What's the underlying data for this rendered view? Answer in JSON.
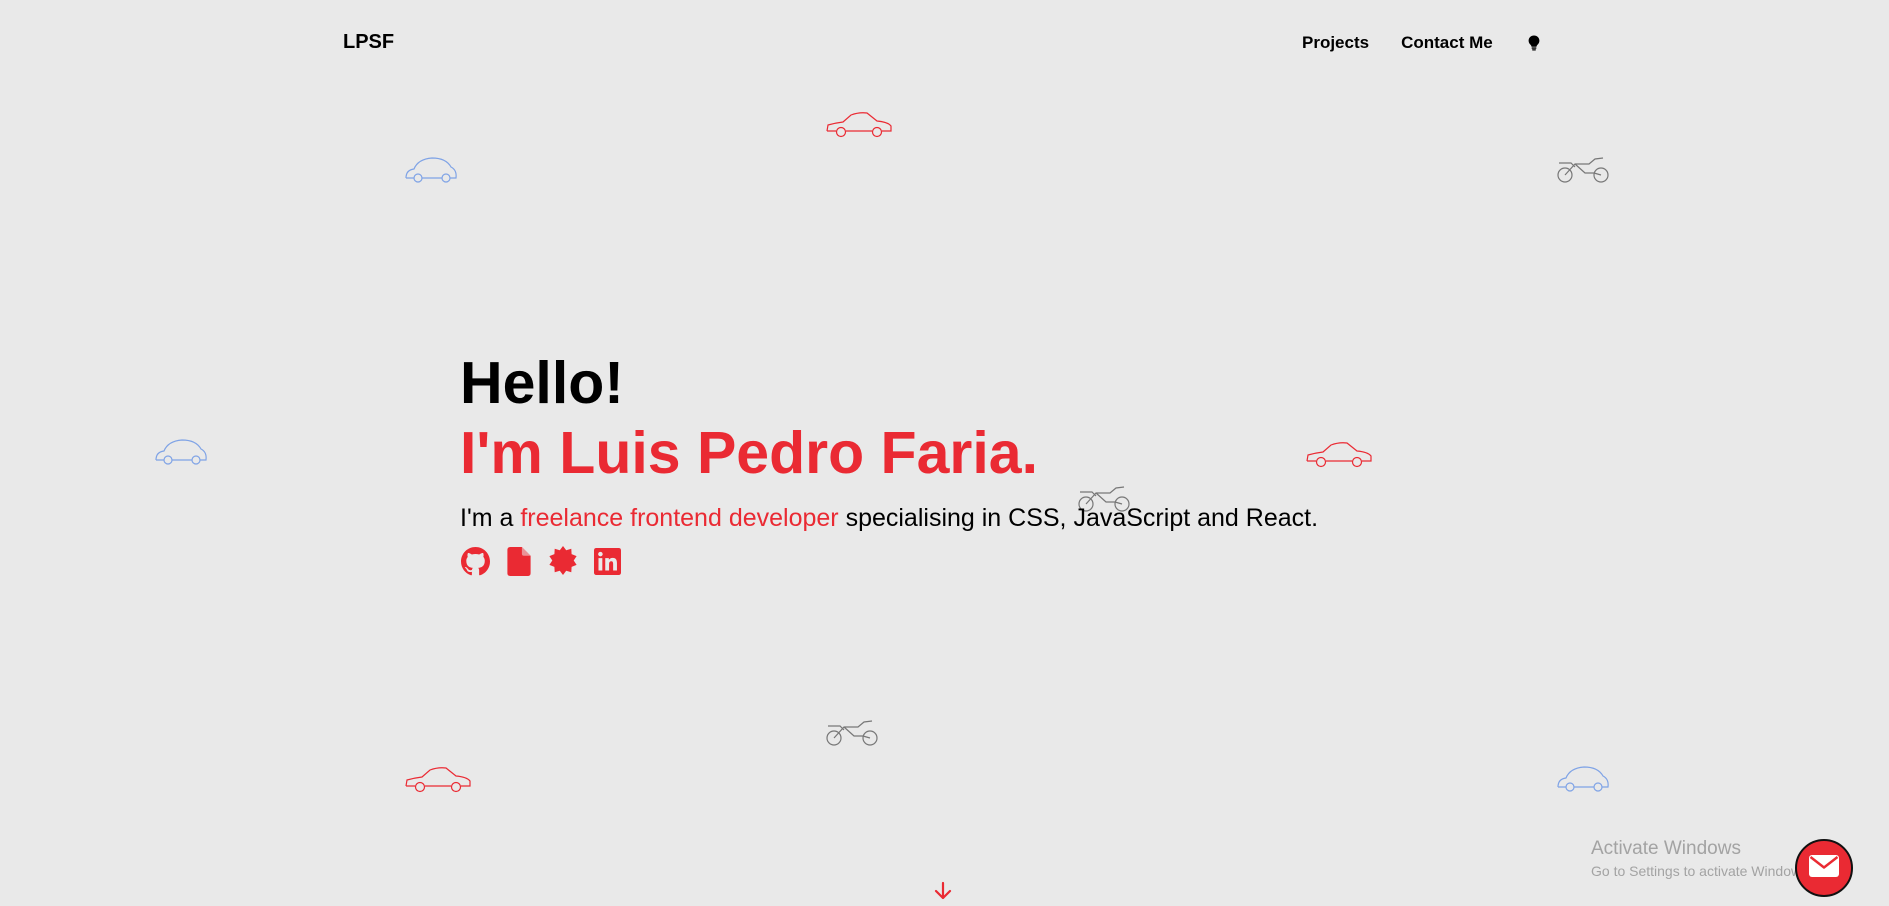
{
  "header": {
    "logo": "LPSF",
    "nav": {
      "projects_label": "Projects",
      "contact_label": "Contact Me"
    },
    "theme_icon": "lightbulb-icon"
  },
  "hero": {
    "greeting": "Hello!",
    "name_line": "I'm Luis Pedro Faria.",
    "tagline_prefix": "I'm a ",
    "tagline_accent": "freelance frontend developer",
    "tagline_suffix": " specialising in CSS, JavaScript and React.",
    "socials": [
      {
        "icon": "github-icon"
      },
      {
        "icon": "document-icon"
      },
      {
        "icon": "badge-icon"
      },
      {
        "icon": "linkedin-icon"
      }
    ]
  },
  "windows_watermark": {
    "title": "Activate Windows",
    "subtitle": "Go to Settings to activate Windows."
  },
  "colors": {
    "accent": "#ea2a33",
    "background": "#e9e9e9",
    "text": "#000000",
    "vehicle_blue": "#7fa3e6",
    "vehicle_red": "#ea2a33",
    "vehicle_gray": "#777777"
  },
  "icons": {
    "scroll": "arrow-down-icon",
    "mail": "envelope-icon"
  }
}
